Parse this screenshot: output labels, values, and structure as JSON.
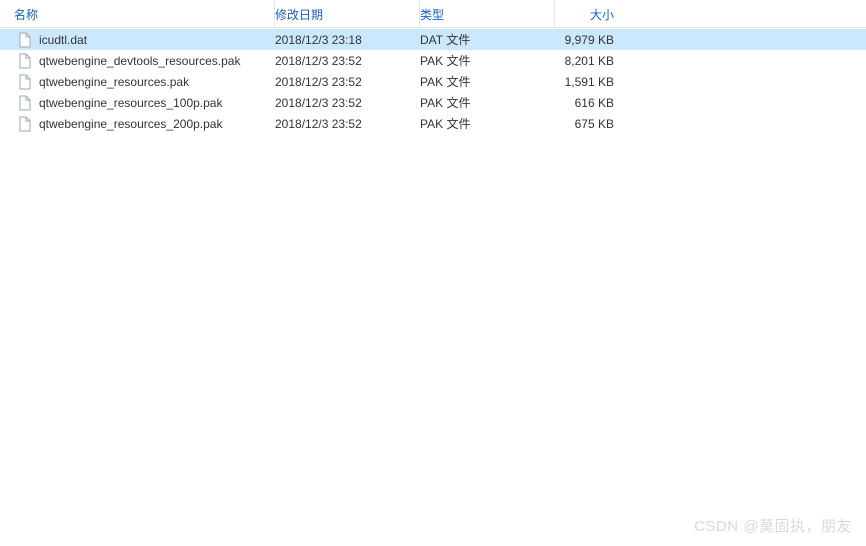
{
  "columns": {
    "name": "名称",
    "date": "修改日期",
    "type": "类型",
    "size": "大小"
  },
  "files": [
    {
      "name": "icudtl.dat",
      "date": "2018/12/3 23:18",
      "type": "DAT 文件",
      "size": "9,979 KB",
      "selected": true
    },
    {
      "name": "qtwebengine_devtools_resources.pak",
      "date": "2018/12/3 23:52",
      "type": "PAK 文件",
      "size": "8,201 KB",
      "selected": false
    },
    {
      "name": "qtwebengine_resources.pak",
      "date": "2018/12/3 23:52",
      "type": "PAK 文件",
      "size": "1,591 KB",
      "selected": false
    },
    {
      "name": "qtwebengine_resources_100p.pak",
      "date": "2018/12/3 23:52",
      "type": "PAK 文件",
      "size": "616 KB",
      "selected": false
    },
    {
      "name": "qtwebengine_resources_200p.pak",
      "date": "2018/12/3 23:52",
      "type": "PAK 文件",
      "size": "675 KB",
      "selected": false
    }
  ],
  "watermark": "CSDN @莫固执，朋友"
}
